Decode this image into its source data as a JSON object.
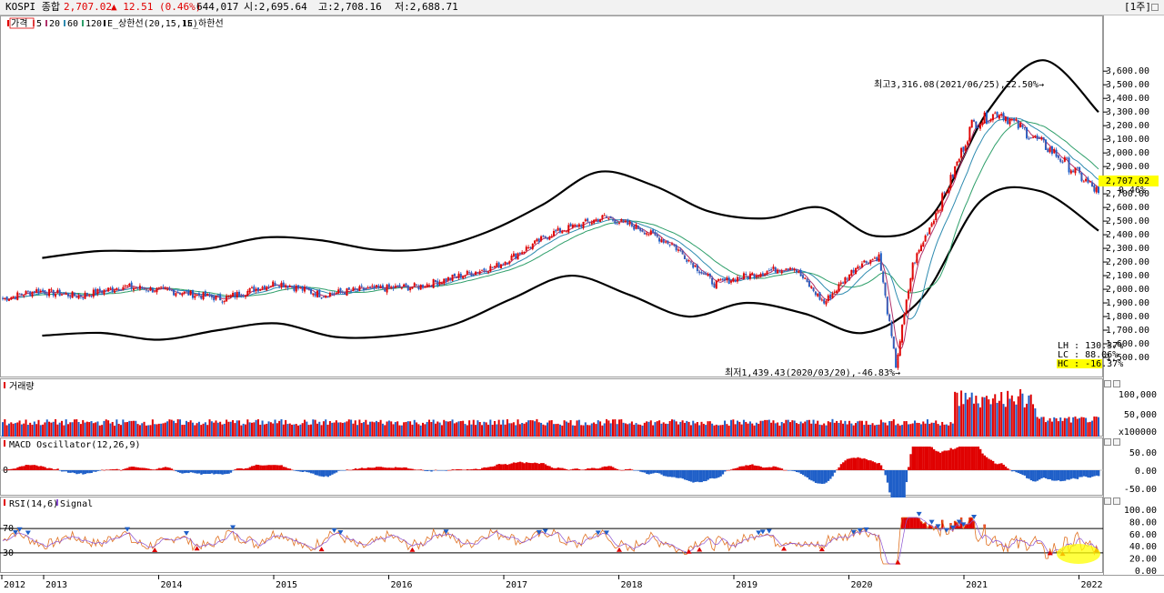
{
  "header": {
    "name": "KOSPI 종합",
    "price": "2,707.02",
    "change": "▲ 12.51 (0.46%)",
    "volume": "644,017",
    "open": "시:2,695.64",
    "high": "고:2,708.16",
    "low": "저:2,688.71",
    "unit": "[1주]"
  },
  "legend": {
    "price": "가격",
    "ma5": "5",
    "ma20": "20",
    "ma60": "60",
    "ma120": "120",
    "upper_env": "E_상한선(20,15,15)",
    "lower_env": "E_하한선"
  },
  "annotations": {
    "high": "최고3,316.08(2021/06/25),22.50%→",
    "low": "최저1,439.43(2020/03/20),-46.83%→",
    "lh": "LH : 130.37%",
    "lc": "LC :  88.06%",
    "hc": "HC : -16.37%",
    "price_tag": "2,707.02",
    "pct_tag": "0.46%"
  },
  "panels": {
    "volume": "거래량",
    "macd": "MACD Oscillator(12,26,9)",
    "rsi": "RSI(14,6)",
    "rsi_signal": "Signal"
  },
  "colors": {
    "up": "#e00000",
    "down": "#1f5fc8",
    "ma5": "#e03c3c",
    "ma20": "#b0306a",
    "ma60": "#2e8bb0",
    "ma120": "#2e9f6a",
    "envelope": "#000000",
    "highlight": "#ffff00"
  },
  "chart_data": [
    {
      "type": "line",
      "title": "KOSPI 종합",
      "x": [
        "2012",
        "2013",
        "2014",
        "2015",
        "2016",
        "2017",
        "2018",
        "2019",
        "2020",
        "2021",
        "2022"
      ],
      "xlabel": "",
      "ylabel": "",
      "ylim": [
        1400,
        3700
      ],
      "y_ticks": [
        "3,600.00",
        "3,500.00",
        "3,400.00",
        "3,300.00",
        "3,200.00",
        "3,100.00",
        "3,000.00",
        "2,900.00",
        "2,800.00",
        "2,700.00",
        "2,600.00",
        "2,500.00",
        "2,400.00",
        "2,300.00",
        "2,200.00",
        "2,100.00",
        "2,000.00",
        "1,900.00",
        "1,800.00",
        "1,700.00",
        "1,600.00",
        "1,500.00"
      ],
      "series": [
        {
          "name": "가격",
          "values": [
            1930,
            1990,
            1950,
            2020,
            1980,
            1930,
            2050,
            1960,
            2000,
            2020,
            2170,
            2410,
            2530,
            2450,
            2330,
            2040,
            2120,
            2170,
            1900,
            2180,
            2240,
            1440,
            2180,
            2800,
            3210,
            3300,
            3000,
            2707
          ]
        },
        {
          "name": "E_상한선(20,15,15)",
          "values": [
            2230,
            2280,
            2280,
            2300,
            2380,
            2360,
            2290,
            2300,
            2420,
            2620,
            2860,
            2760,
            2570,
            2520,
            2600,
            2390,
            2540,
            3300,
            3680,
            3300
          ]
        },
        {
          "name": "E_하한선",
          "values": [
            1660,
            1680,
            1630,
            1700,
            1750,
            1650,
            1660,
            1740,
            1930,
            2100,
            1960,
            1800,
            1900,
            1820,
            1680,
            1940,
            2650,
            2720,
            2430
          ]
        }
      ]
    },
    {
      "type": "bar",
      "title": "거래량",
      "y_ticks": [
        "100,000",
        "50,000",
        "x100000"
      ]
    },
    {
      "type": "bar",
      "title": "MACD Oscillator(12,26,9)",
      "y_ticks": [
        "50.00",
        "0.00",
        "-50.00"
      ],
      "zero_label": "0"
    },
    {
      "type": "line",
      "title": "RSI(14,6)",
      "ylim": [
        0,
        100
      ],
      "y_ticks": [
        "100.00",
        "80.00",
        "60.00",
        "40.00",
        "20.00",
        "0.00"
      ],
      "levels": [
        70,
        30
      ],
      "level_labels": [
        "70",
        "30"
      ]
    }
  ]
}
